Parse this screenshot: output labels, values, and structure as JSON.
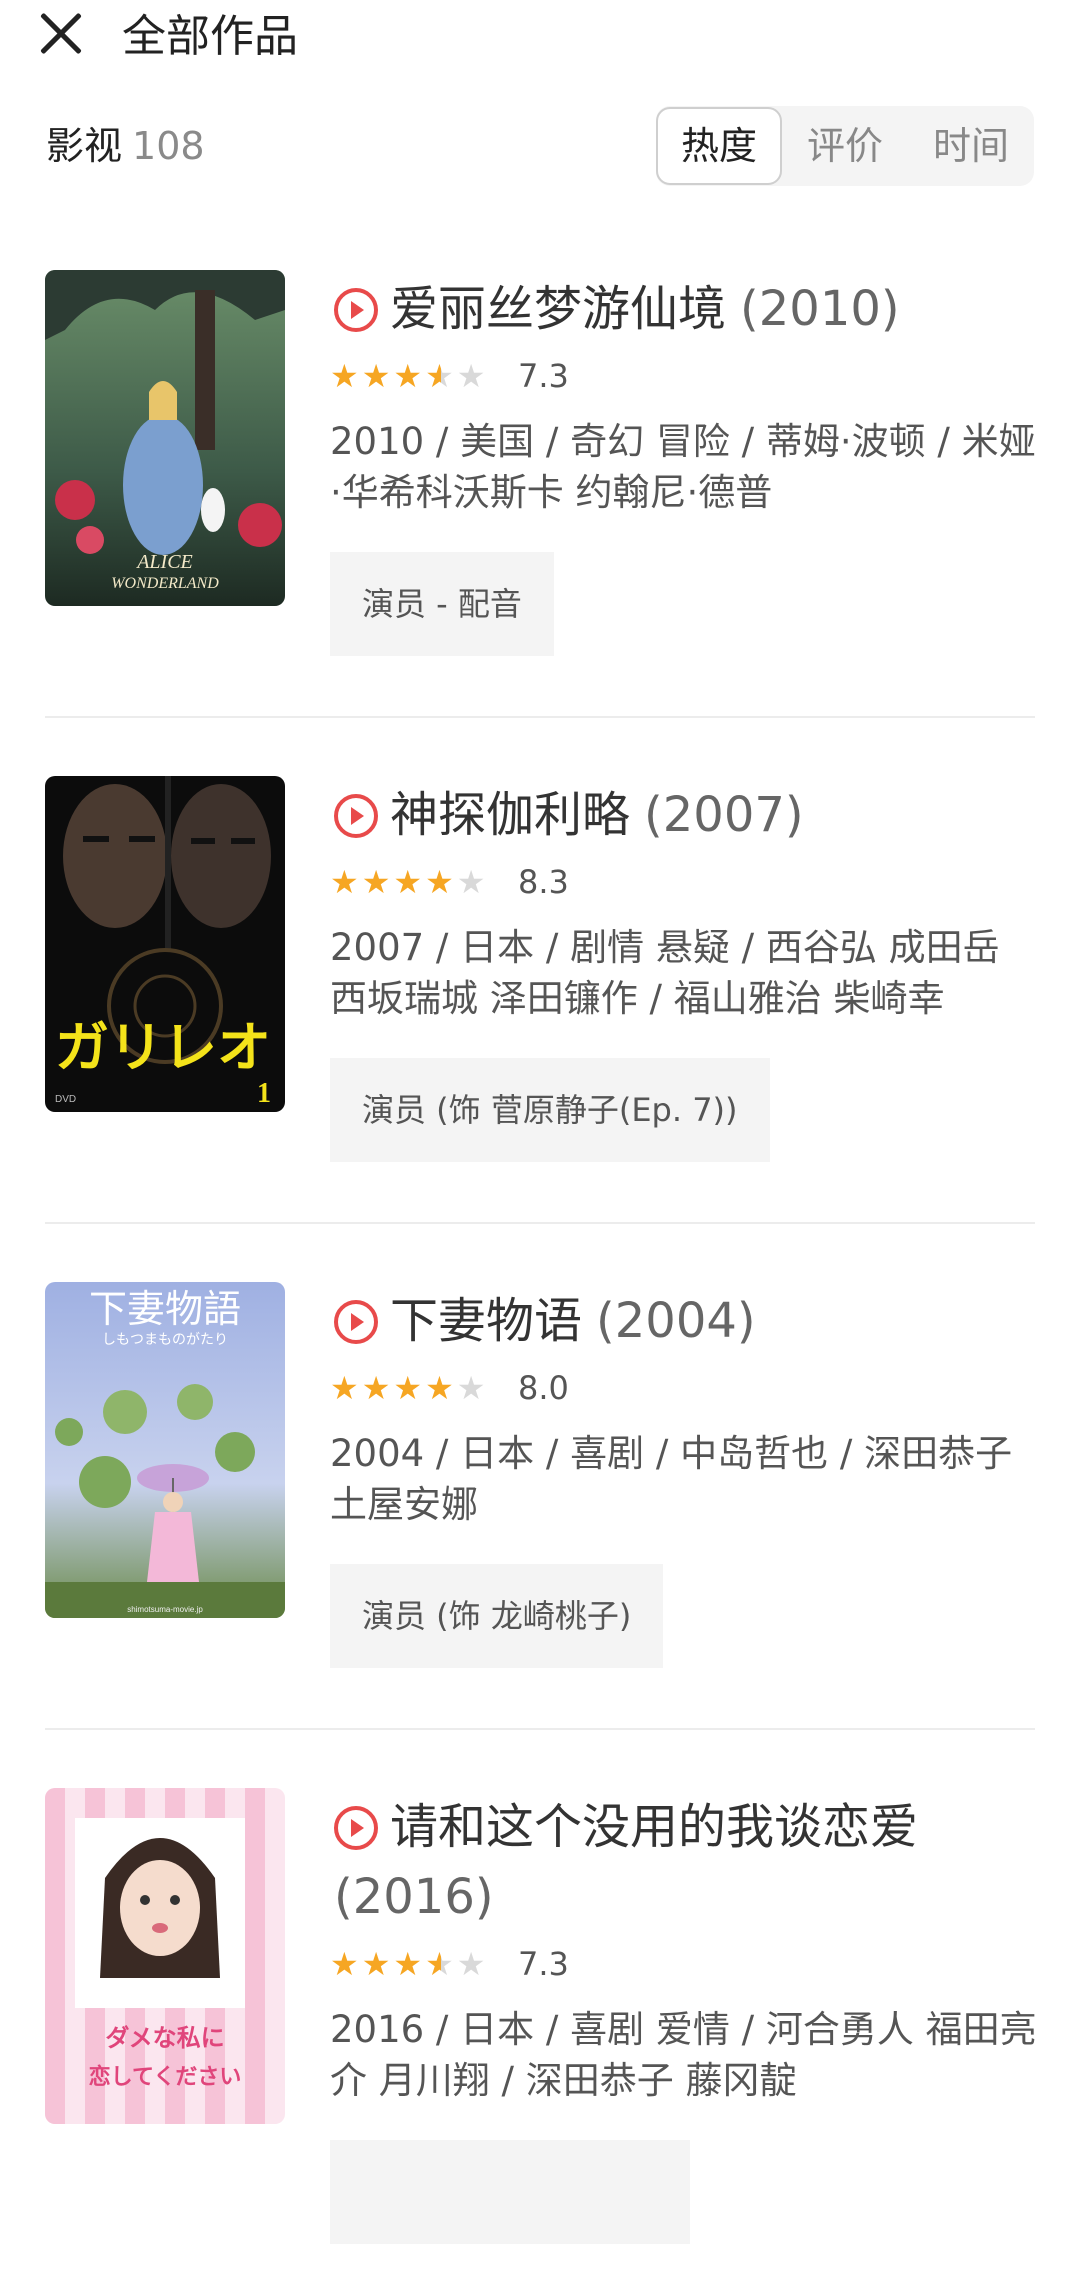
{
  "header": {
    "close_icon": "close-icon",
    "title": "全部作品"
  },
  "section": {
    "label": "影视",
    "count": "108"
  },
  "sort_tabs": [
    {
      "label": "热度",
      "active": true
    },
    {
      "label": "评价",
      "active": false
    },
    {
      "label": "时间",
      "active": false
    }
  ],
  "items": [
    {
      "title": "爱丽丝梦游仙境",
      "year": "(2010)",
      "stars": 3.5,
      "score": "7.3",
      "meta": "2010 / 美国 / 奇幻 冒险 / 蒂姆·波顿 / 米娅·华希科沃斯卡 约翰尼·德普",
      "role": "演员 - 配音",
      "poster": {
        "text": "ALICE IN WONDERLAND",
        "icon": "fantasy-poster"
      }
    },
    {
      "title": "神探伽利略",
      "year": "(2007)",
      "stars": 4,
      "score": "8.3",
      "meta": "2007 / 日本 / 剧情 悬疑 / 西谷弘 成田岳 西坂瑞城 泽田镰作 / 福山雅治 柴崎幸",
      "role": "演员 (饰 菅原静子(Ep. 7))",
      "poster": {
        "text": "ガリレオ",
        "icon": "drama-poster"
      }
    },
    {
      "title": "下妻物语",
      "year": "(2004)",
      "stars": 4,
      "score": "8.0",
      "meta": "2004 / 日本 / 喜剧 / 中岛哲也 / 深田恭子 土屋安娜",
      "role": "演员 (饰 龙崎桃子)",
      "poster": {
        "text": "下妻物語",
        "icon": "comedy-poster"
      }
    },
    {
      "title": "请和这个没用的我谈恋爱",
      "year": "(2016)",
      "stars": 3.5,
      "score": "7.3",
      "meta": "2016 / 日本 / 喜剧 爱情 / 河合勇人 福田亮介 月川翔 / 深田恭子 藤冈靛",
      "role": "",
      "poster": {
        "text": "ダメな私に恋してください",
        "icon": "romance-poster"
      }
    }
  ],
  "colors": {
    "accent": "#e84a4a",
    "star": "#f6a623",
    "star_empty": "#d9d9d9",
    "role_bg": "#f4f4f4"
  }
}
